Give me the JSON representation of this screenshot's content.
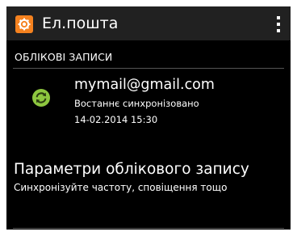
{
  "action_bar": {
    "title": "Ел.пошта",
    "app_icon": "settings-gear-icon",
    "overflow_icon": "overflow-menu-icon",
    "background": "#212121",
    "icon_color": "#f5821f"
  },
  "accounts_section": {
    "header": "ОБЛІКОВІ ЗАПИСИ",
    "items": [
      {
        "email": "mymail@gmail.com",
        "status": "Востаннє синхронізовано",
        "timestamp": "14-02.2014 15:30",
        "icon": "sync-icon",
        "icon_color": "#8dc63f"
      }
    ]
  },
  "settings": {
    "title": "Параметри облікового запису",
    "subtitle": "Синхронізуйте частоту, сповіщення тощо"
  }
}
